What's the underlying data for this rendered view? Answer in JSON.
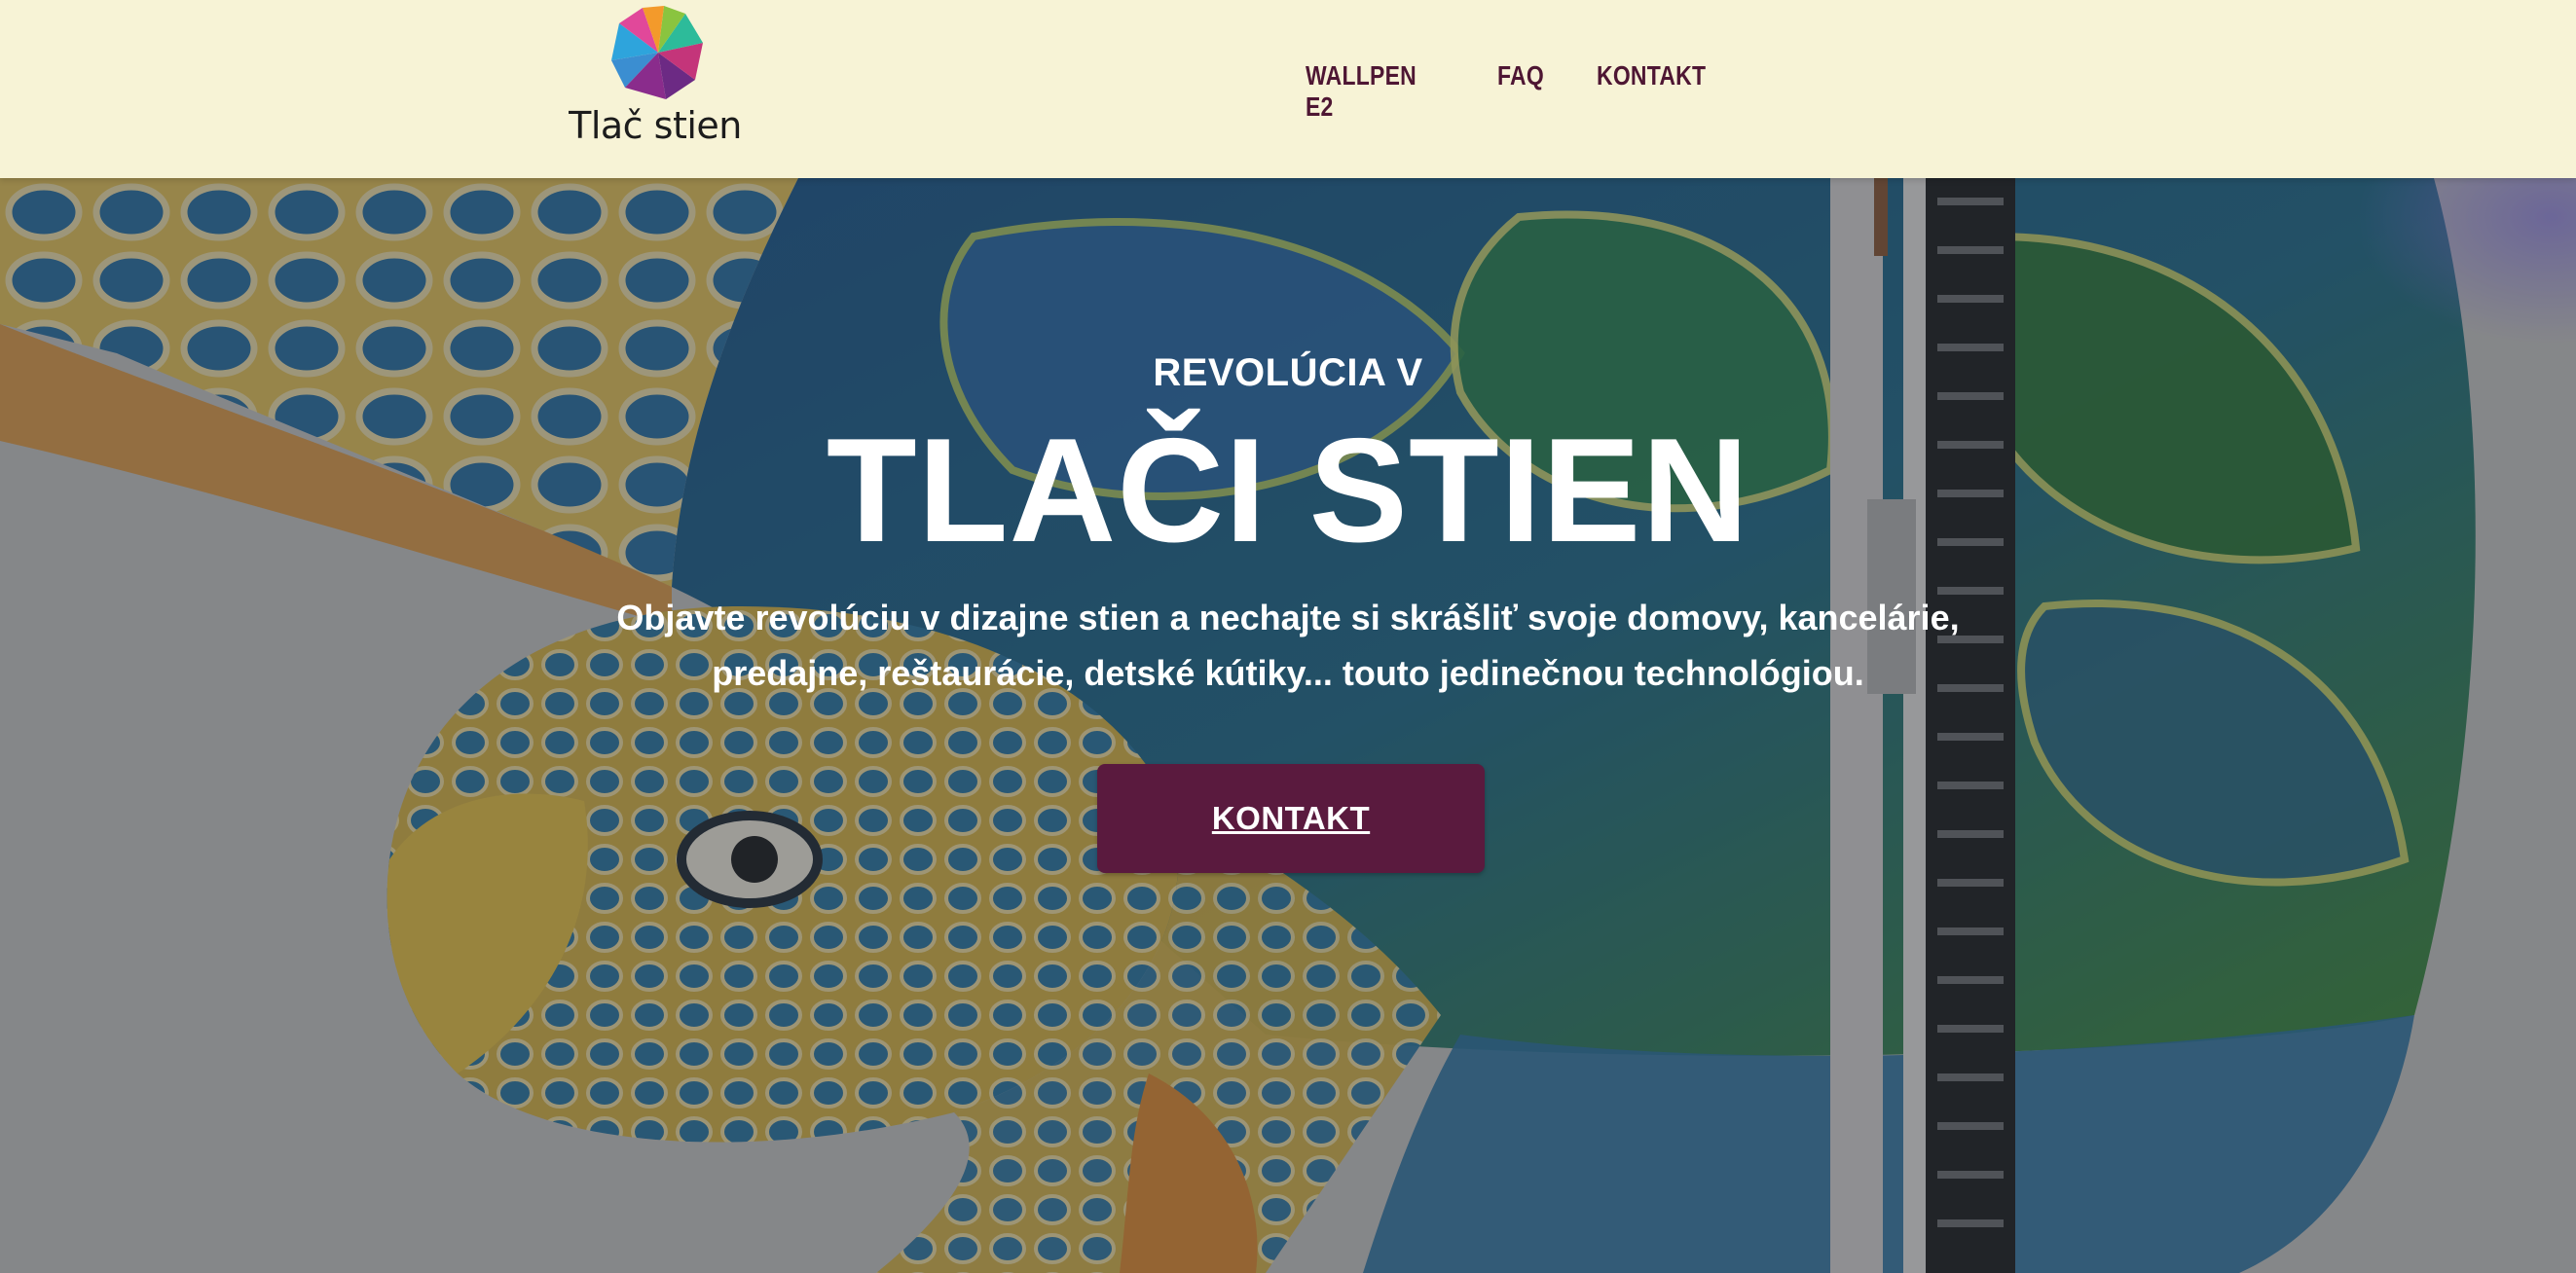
{
  "brand": {
    "name": "Tlač stien",
    "colors": {
      "header_bg": "#f7f3d6",
      "nav_text": "#4e1633",
      "cta_bg": "#5a1a3e"
    }
  },
  "nav": {
    "items": [
      {
        "label": "WALLPEN E2"
      },
      {
        "label": "FAQ"
      },
      {
        "label": "KONTAKT"
      }
    ]
  },
  "hero": {
    "eyebrow": "REVOLÚCIA V",
    "headline": "TLAČI STIEN",
    "lead_line1": "Objavte revolúciu v dizajne stien a nechajte si skrášliť svoje domovy, kancelárie,",
    "lead_line2": "predajne, reštaurácie, detské kútiky... touto jedinečnou technológiou.",
    "cta_label": "KONTAKT",
    "background": "sea-turtle-wall-print-image"
  }
}
